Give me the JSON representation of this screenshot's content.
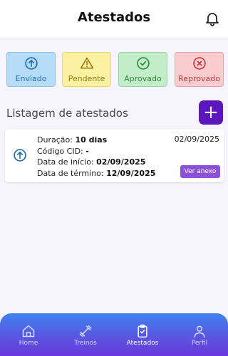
{
  "header": {
    "title": "Atestados",
    "icon": "bell-icon"
  },
  "status_filters": [
    {
      "label": "Enviado",
      "icon": "arrow-up-circle-icon",
      "color": "#1f6fa8"
    },
    {
      "label": "Pendente",
      "icon": "warning-triangle-icon",
      "color": "#9a7a10"
    },
    {
      "label": "Aprovado",
      "icon": "check-circle-icon",
      "color": "#2f8a3a"
    },
    {
      "label": "Reprovado",
      "icon": "x-circle-icon",
      "color": "#c53a3e"
    }
  ],
  "list": {
    "title": "Listagem de atestados",
    "add_label": "+",
    "items": [
      {
        "status_icon": "arrow-up-circle-icon",
        "date": "02/09/2025",
        "duration_label": "Duração:",
        "duration_value": "10 dias",
        "cid_label": "Código CID:",
        "cid_value": "-",
        "start_label": "Data de início:",
        "start_value": "02/09/2025",
        "end_label": "Data de término:",
        "end_value": "12/09/2025",
        "attachment_label": "Ver anexo"
      }
    ]
  },
  "bottom_nav": [
    {
      "label": "Home",
      "icon": "home-icon"
    },
    {
      "label": "Treinos",
      "icon": "dumbbell-icon"
    },
    {
      "label": "Atestados",
      "icon": "clipboard-check-icon",
      "active": true
    },
    {
      "label": "Perfil",
      "icon": "person-icon"
    }
  ],
  "colors": {
    "accent": "#5b17bd",
    "nav_gradient_start": "#3f82f0",
    "nav_gradient_end": "#6a38dd"
  }
}
